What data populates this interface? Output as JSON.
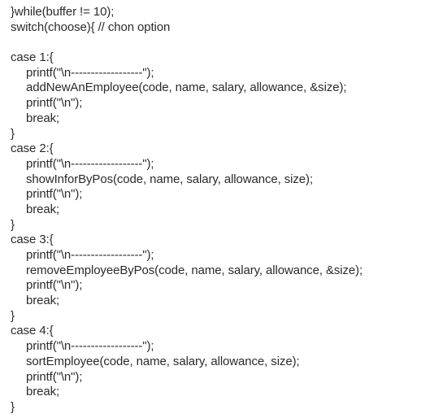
{
  "code": {
    "lines": [
      "}while(buffer != 10);",
      "switch(choose){ // chon option",
      "",
      "case 1:{",
      "printf(\"\\n------------------\");",
      "addNewAnEmployee(code, name, salary, allowance, &size);",
      "printf(\"\\n\");",
      "break;",
      "}",
      "case 2:{",
      "printf(\"\\n------------------\");",
      "showInforByPos(code, name, salary, allowance, size);",
      "printf(\"\\n\");",
      "break;",
      "}",
      "case 3:{",
      "printf(\"\\n------------------\");",
      "removeEmployeeByPos(code, name, salary, allowance, &size);",
      "printf(\"\\n\");",
      "break;",
      "}",
      "case 4:{",
      "printf(\"\\n------------------\");",
      "sortEmployee(code, name, salary, allowance, size);",
      "printf(\"\\n\");",
      "break;",
      "}"
    ]
  }
}
